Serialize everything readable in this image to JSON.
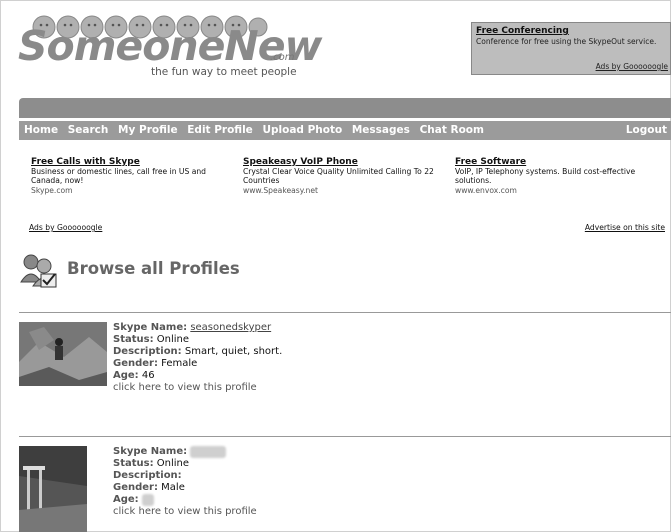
{
  "logo": {
    "name": "SomeoneNew",
    "com": ".com",
    "tagline": "the fun way to meet people"
  },
  "top_ad": {
    "title": "Free Conferencing",
    "desc": "Conference for free using the SkypeOut service.",
    "attribution": "Ads by Goooooogle"
  },
  "nav": {
    "items": [
      "Home",
      "Search",
      "My Profile",
      "Edit Profile",
      "Upload Photo",
      "Messages",
      "Chat Room"
    ],
    "logout": "Logout"
  },
  "text_ads": [
    {
      "title": "Free Calls with Skype",
      "desc": "Business or domestic lines, call free in US and Canada, now!",
      "url": "Skype.com"
    },
    {
      "title": "Speakeasy VoIP Phone",
      "desc": "Crystal Clear Voice Quality Unlimited Calling To 22 Countries",
      "url": "www.Speakeasy.net"
    },
    {
      "title": "Free Software",
      "desc": "VoIP, IP Telephony systems. Build cost-effective solutions.",
      "url": "www.envox.com"
    }
  ],
  "ads_by": "Ads by Goooooogle",
  "advertise": "Advertise on this site",
  "page_title": "Browse all Profiles",
  "labels": {
    "skype_name": "Skype Name:",
    "status": "Status:",
    "description": "Description:",
    "gender": "Gender:",
    "age": "Age:",
    "view": "click here to view this profile"
  },
  "profiles": [
    {
      "skype_name": "seasonedskyper",
      "status": "Online",
      "description": "Smart, quiet, short.",
      "gender": "Female",
      "age": "46"
    },
    {
      "skype_name": "",
      "status": "Online",
      "description": "",
      "gender": "Male",
      "age": ""
    }
  ]
}
